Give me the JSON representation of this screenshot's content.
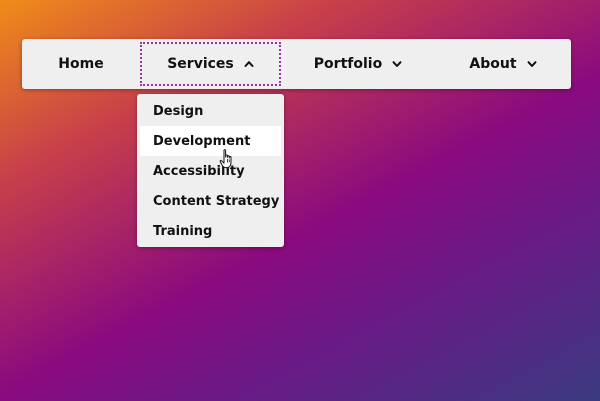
{
  "nav": {
    "items": [
      {
        "label": "Home"
      },
      {
        "label": "Services",
        "expanded": true
      },
      {
        "label": "Portfolio"
      },
      {
        "label": "About"
      }
    ]
  },
  "dropdown": {
    "items": [
      {
        "label": "Design"
      },
      {
        "label": "Development",
        "hovered": true
      },
      {
        "label": "Accessibility"
      },
      {
        "label": "Content Strategy"
      },
      {
        "label": "Training"
      }
    ]
  },
  "icons": {
    "services_chevron": "chevron-up-icon",
    "portfolio_chevron": "chevron-down-icon",
    "about_chevron": "chevron-down-icon",
    "cursor": "hand-pointer-cursor-icon"
  },
  "colors": {
    "focus_outline": "#9b30b0",
    "bar_background": "#efefef",
    "hover_background": "#ffffff"
  }
}
